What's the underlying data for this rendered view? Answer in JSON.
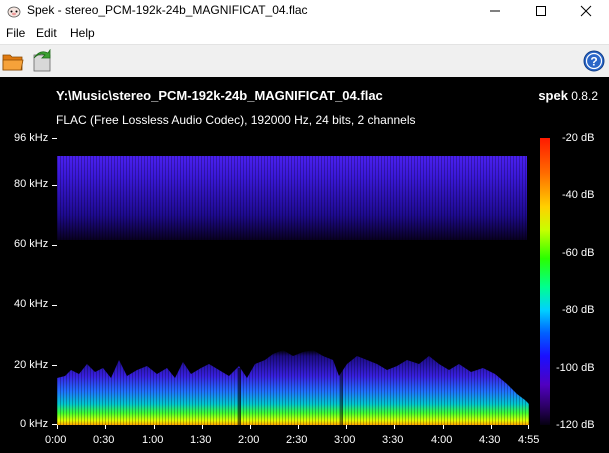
{
  "window": {
    "title": "Spek - stereo_PCM-192k-24b_MAGNIFICAT_04.flac"
  },
  "menu": {
    "items": [
      "File",
      "Edit",
      "Help"
    ]
  },
  "toolbar": {
    "icons": [
      "open-file-icon",
      "save-image-icon",
      "help-icon"
    ]
  },
  "spectrogram": {
    "filename": "Y:\\Music\\stereo_PCM-192k-24b_MAGNIFICAT_04.flac",
    "app_name": "spek",
    "app_version": "0.8.2",
    "info": "FLAC (Free Lossless Audio Codec), 192000 Hz, 24 bits, 2 channels",
    "freq_labels": [
      "96 kHz",
      "80 kHz",
      "60 kHz",
      "40 kHz",
      "20 kHz",
      "0 kHz"
    ],
    "time_labels": [
      "0:00",
      "0:30",
      "1:00",
      "1:30",
      "2:00",
      "2:30",
      "3:00",
      "3:30",
      "4:00",
      "4:30",
      "4:55"
    ],
    "db_labels": [
      "-20 dB",
      "-40 dB",
      "-60 dB",
      "-80 dB",
      "-100 dB",
      "-120 dB"
    ]
  },
  "colors": {
    "background": "#000000",
    "noise_band": "#3a18e0",
    "low_high": "#ffd000",
    "low_mid": "#2aff00"
  }
}
